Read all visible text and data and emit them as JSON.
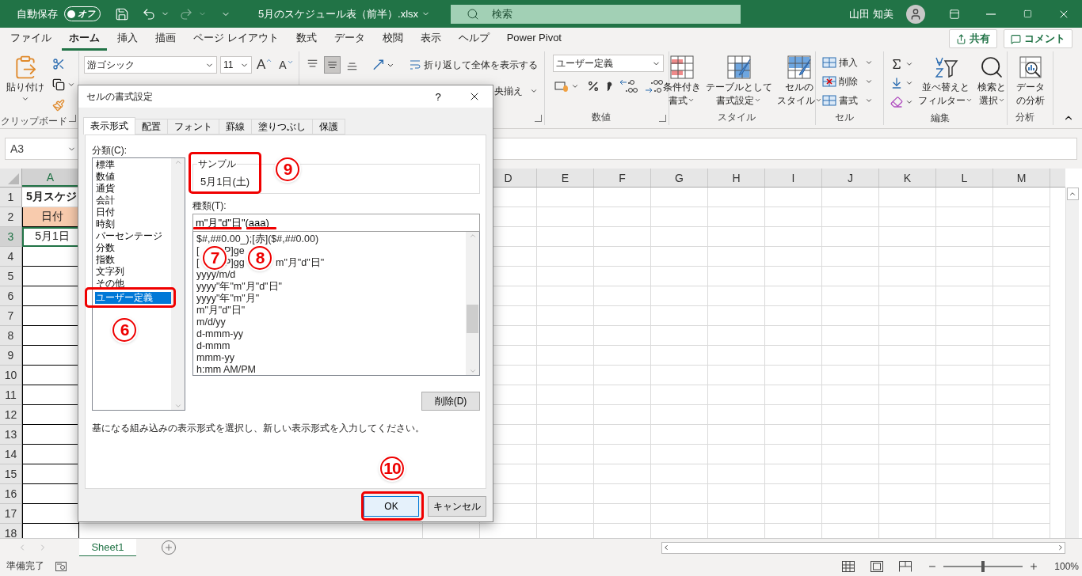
{
  "title_bar": {
    "autosave_label": "自動保存",
    "autosave_toggle": {
      "label": "オフ",
      "on": false
    },
    "filename": "5月のスケジュール表（前半）.xlsx",
    "search": {
      "placeholder": "検索"
    },
    "user": "山田 知美"
  },
  "menu_tabs": [
    {
      "label": "ファイル",
      "selected": false
    },
    {
      "label": "ホーム",
      "selected": true
    },
    {
      "label": "挿入",
      "selected": false
    },
    {
      "label": "描画",
      "selected": false
    },
    {
      "label": "ページ レイアウト",
      "selected": false
    },
    {
      "label": "数式",
      "selected": false
    },
    {
      "label": "データ",
      "selected": false
    },
    {
      "label": "校閲",
      "selected": false
    },
    {
      "label": "表示",
      "selected": false
    },
    {
      "label": "ヘルプ",
      "selected": false
    },
    {
      "label": "Power Pivot",
      "selected": false
    }
  ],
  "share_button": "共有",
  "comment_button": "コメント",
  "ribbon": {
    "clipboard": {
      "paste": "貼り付け",
      "label": "クリップボード"
    },
    "font": {
      "font_name": "游ゴシック",
      "font_size": "11",
      "grow": "A",
      "shrink": "A"
    },
    "alignment": {
      "wrap_text": "折り返して全体を表示する",
      "merge_center": "央揃え"
    },
    "number": {
      "format": "ユーザー定義",
      "label": "数値"
    },
    "styles": {
      "buttons": [
        {
          "line1": "条件付き",
          "line2": "書式"
        },
        {
          "line1": "テーブルとして",
          "line2": "書式設定"
        },
        {
          "line1": "セルの",
          "line2": "スタイル"
        }
      ],
      "label": "スタイル"
    },
    "cells": {
      "buttons": [
        "挿入",
        "削除",
        "書式"
      ],
      "label": "セル"
    },
    "editing": {
      "buttons": [
        {
          "line1": "並べ替えと",
          "line2": "フィルター"
        },
        {
          "line1": "検索と",
          "line2": "選択"
        }
      ],
      "label": "編集"
    },
    "analysis": {
      "button": {
        "line1": "データ",
        "line2": "の分析"
      },
      "label": "分析"
    }
  },
  "formula_bar": {
    "name_box": "A3"
  },
  "sheet": {
    "columns": [
      "A",
      "D",
      "E",
      "F",
      "G",
      "H",
      "I",
      "J",
      "K",
      "L",
      "M"
    ],
    "row_numbers": [
      "1",
      "2",
      "3",
      "4",
      "5",
      "6",
      "7",
      "8",
      "9",
      "10",
      "11",
      "12",
      "13",
      "14",
      "15",
      "16",
      "17",
      "18"
    ],
    "cells": [
      {
        "text": "5月スケジ",
        "kind": "title",
        "selected": false
      },
      {
        "text": "日付",
        "kind": "header",
        "selected": false
      },
      {
        "text": "5月1日",
        "kind": "value",
        "selected": true
      }
    ]
  },
  "sheet_tabs": [
    {
      "label": "Sheet1",
      "selected": true
    }
  ],
  "status_bar": {
    "status": "準備完了",
    "zoom": {
      "level": 0.5,
      "reading": "100%"
    }
  },
  "dialog": {
    "title": "セルの書式設定",
    "help": "?",
    "tabs": [
      {
        "label": "表示形式",
        "selected": true
      },
      {
        "label": "配置",
        "selected": false
      },
      {
        "label": "フォント",
        "selected": false
      },
      {
        "label": "罫線",
        "selected": false
      },
      {
        "label": "塗りつぶし",
        "selected": false
      },
      {
        "label": "保護",
        "selected": false
      }
    ],
    "category_label": "分類(C):",
    "categories": [
      {
        "label": "標準",
        "selected": false
      },
      {
        "label": "数値",
        "selected": false
      },
      {
        "label": "通貨",
        "selected": false
      },
      {
        "label": "会計",
        "selected": false
      },
      {
        "label": "日付",
        "selected": false
      },
      {
        "label": "時刻",
        "selected": false
      },
      {
        "label": "パーセンテージ",
        "selected": false
      },
      {
        "label": "分数",
        "selected": false
      },
      {
        "label": "指数",
        "selected": false
      },
      {
        "label": "文字列",
        "selected": false
      },
      {
        "label": "その他",
        "selected": false
      },
      {
        "label": "ユーザー定義",
        "selected": true
      }
    ],
    "sample": {
      "label": "サンプル",
      "value": "5月1日(土)"
    },
    "type_label": "種類(T):",
    "type_value": "m\"月\"d\"日\"(aaa)",
    "formats": [
      {
        "parts": [
          "$#,##0.00_);[赤]($#,##0.00)"
        ]
      },
      {
        "parts": [
          "[",
          "P]ge"
        ]
      },
      {
        "parts": [
          "[",
          "P]gg",
          "m\"月\"d\"日\""
        ]
      },
      {
        "parts": [
          "yyyy/m/d"
        ]
      },
      {
        "parts": [
          "yyyy\"年\"m\"月\"d\"日\""
        ]
      },
      {
        "parts": [
          "yyyy\"年\"m\"月\""
        ]
      },
      {
        "parts": [
          "m\"月\"d\"日\""
        ]
      },
      {
        "parts": [
          "m/d/yy"
        ]
      },
      {
        "parts": [
          "d-mmm-yy"
        ]
      },
      {
        "parts": [
          "d-mmm"
        ]
      },
      {
        "parts": [
          "mmm-yy"
        ]
      },
      {
        "parts": [
          "h:mm AM/PM"
        ]
      }
    ],
    "delete_button": "削除(D)",
    "description": "基になる組み込みの表示形式を選択し、新しい表示形式を入力してください。",
    "ok_button": "OK",
    "cancel_button": "キャンセル"
  },
  "annotations": [
    {
      "number": "6"
    },
    {
      "number": "7"
    },
    {
      "number": "8"
    },
    {
      "number": "9"
    },
    {
      "number": "10"
    }
  ]
}
